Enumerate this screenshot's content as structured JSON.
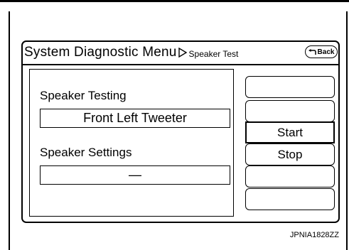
{
  "header": {
    "title": "System Diagnostic Menu",
    "subtitle": "Speaker Test",
    "back_label": "Back"
  },
  "panel": {
    "testing_label": "Speaker Testing",
    "testing_value": "Front Left Tweeter",
    "settings_label": "Speaker Settings",
    "settings_value": "—"
  },
  "buttons": {
    "start_label": "Start",
    "stop_label": "Stop",
    "selected": "Start"
  },
  "caption": "JPNIA1828ZZ"
}
